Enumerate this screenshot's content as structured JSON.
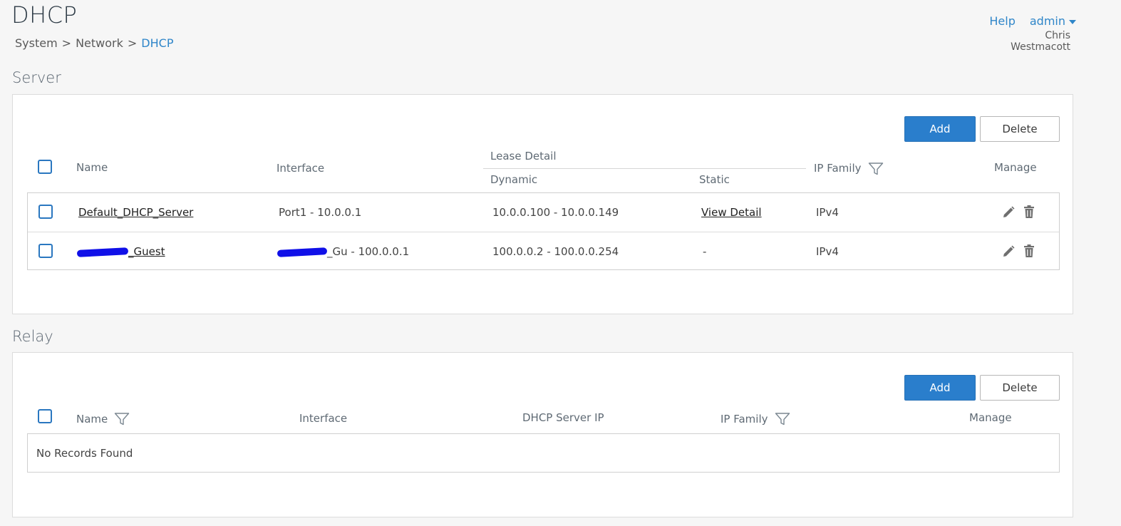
{
  "header": {
    "title": "DHCP",
    "breadcrumb": {
      "system": "System",
      "network": "Network",
      "current": "DHCP",
      "separator": ">"
    },
    "help_label": "Help",
    "admin_label": "admin",
    "user_name": "Chris Westmacott"
  },
  "server": {
    "section_title": "Server",
    "add_label": "Add",
    "delete_label": "Delete",
    "columns": {
      "name": "Name",
      "interface": "Interface",
      "lease_detail": "Lease Detail",
      "dynamic": "Dynamic",
      "static": "Static",
      "ip_family": "IP Family",
      "manage": "Manage"
    },
    "rows": [
      {
        "name": "Default_DHCP_Server",
        "interface": "Port1 - 10.0.0.1",
        "dynamic": "10.0.0.100 - 10.0.0.149",
        "static": "View Detail",
        "ip_family": "IPv4"
      },
      {
        "name": "_Guest",
        "interface": "_Gu - 100.0.0.1",
        "dynamic": "100.0.0.2 - 100.0.0.254",
        "static": "-",
        "ip_family": "IPv4"
      }
    ]
  },
  "relay": {
    "section_title": "Relay",
    "add_label": "Add",
    "delete_label": "Delete",
    "columns": {
      "name": "Name",
      "interface": "Interface",
      "dhcp_server_ip": "DHCP Server IP",
      "ip_family": "IP Family",
      "manage": "Manage"
    },
    "empty_message": "No Records Found"
  },
  "colors": {
    "accent": "#2a7ecc",
    "link": "#2f86c9",
    "redaction": "#1010e8"
  },
  "icons": {
    "filter": "filter-icon",
    "edit": "pencil-icon",
    "delete": "trash-icon",
    "dropdown": "caret-down-icon"
  }
}
